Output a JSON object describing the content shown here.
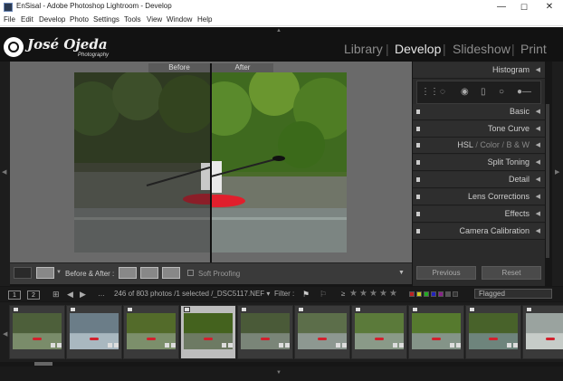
{
  "window": {
    "title": "EnSisal - Adobe Photoshop Lightroom - Develop",
    "min": "—",
    "max": "☐",
    "close": "✕"
  },
  "menu": [
    "File",
    "Edit",
    "Develop",
    "Photo",
    "Settings",
    "Tools",
    "View",
    "Window",
    "Help"
  ],
  "identity": {
    "logo_text": "José Ojeda",
    "logo_sub": "Photography"
  },
  "modules": [
    "Library",
    "Develop",
    "Slideshow",
    "Print"
  ],
  "active_module": "Develop",
  "view": {
    "before_label": "Before",
    "after_label": "After"
  },
  "toolbar": {
    "before_after_label": "Before & After :",
    "soft_proofing": "Soft Proofing"
  },
  "right_panel": {
    "sections": [
      "Histogram",
      "Basic",
      "Tone Curve",
      "HSL / Color / B & W",
      "Split Toning",
      "Detail",
      "Lens Corrections",
      "Effects",
      "Camera Calibration"
    ],
    "hsl_parts": [
      "HSL",
      "/",
      "Color",
      "/",
      "B & W"
    ],
    "previous_button": "Previous",
    "reset_button": "Reset"
  },
  "filmstrip_bar": {
    "page1": "1",
    "page2": "2",
    "info": "246 of 803 photos /1 selected /_DSC5117.NEF ▾",
    "filter_label": "Filter :",
    "rating_op": "≥",
    "flag_filter": "Flagged"
  },
  "colors": {
    "accent_active": "#e6e6e6",
    "panel": "#2b2b2b",
    "background": "#161616"
  },
  "thumbnails_count": 10,
  "selected_thumbnail": 3
}
